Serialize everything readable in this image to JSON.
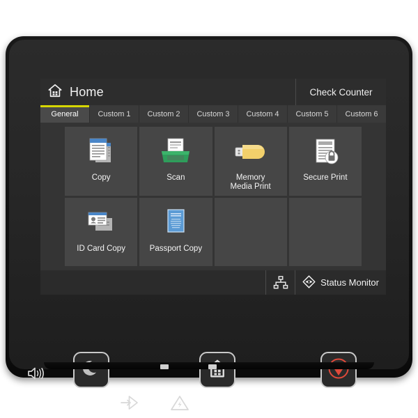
{
  "device": {
    "type": "printer-control-panel",
    "bezel_color": "#141414",
    "screen_bg": "#2e2e2e"
  },
  "screen": {
    "titlebar": {
      "home_icon": "home-icon",
      "title": "Home",
      "check_counter_label": "Check Counter"
    },
    "tabs": [
      {
        "label": "General",
        "active": true
      },
      {
        "label": "Custom 1",
        "active": false
      },
      {
        "label": "Custom 2",
        "active": false
      },
      {
        "label": "Custom 3",
        "active": false
      },
      {
        "label": "Custom 4",
        "active": false
      },
      {
        "label": "Custom 5",
        "active": false
      },
      {
        "label": "Custom 6",
        "active": false
      }
    ],
    "active_tab_accent": "#d7d700",
    "tiles": [
      {
        "label": "Copy",
        "icon": "copy-documents-icon",
        "icon_color": "#4a86c8"
      },
      {
        "label": "Scan",
        "icon": "scanner-tray-icon",
        "icon_color": "#2e9e5b"
      },
      {
        "label": "Memory\nMedia Print",
        "icon": "usb-drive-icon",
        "icon_color": "#f2d06b"
      },
      {
        "label": "Secure Print",
        "icon": "document-lock-icon",
        "icon_color": "#d5d5d5"
      },
      {
        "label": "ID Card Copy",
        "icon": "id-card-icon",
        "icon_color": "#4a86c8"
      },
      {
        "label": "Passport Copy",
        "icon": "passport-book-icon",
        "icon_color": "#5b9bd5"
      }
    ],
    "empty_tile_count": 2,
    "statusbar": {
      "network_icon": "network-nodes-icon",
      "status_monitor_icon": "status-monitor-diamond-icon",
      "status_monitor_label": "Status Monitor"
    }
  },
  "hardkeys": [
    {
      "name": "sleep",
      "icon": "crescent-moon-icon",
      "color": "#c9c9c9"
    },
    {
      "name": "home",
      "icon": "home-house-icon",
      "color": "#d9d9d9"
    },
    {
      "name": "stop",
      "icon": "stop-triangle-icon",
      "color": "#e04b3a"
    }
  ],
  "indicators": {
    "speaker_icon": "speaker-volume-icon",
    "data_icon": "data-arrow-diamond-icon",
    "error_icon": "error-warning-triangle-icon"
  }
}
